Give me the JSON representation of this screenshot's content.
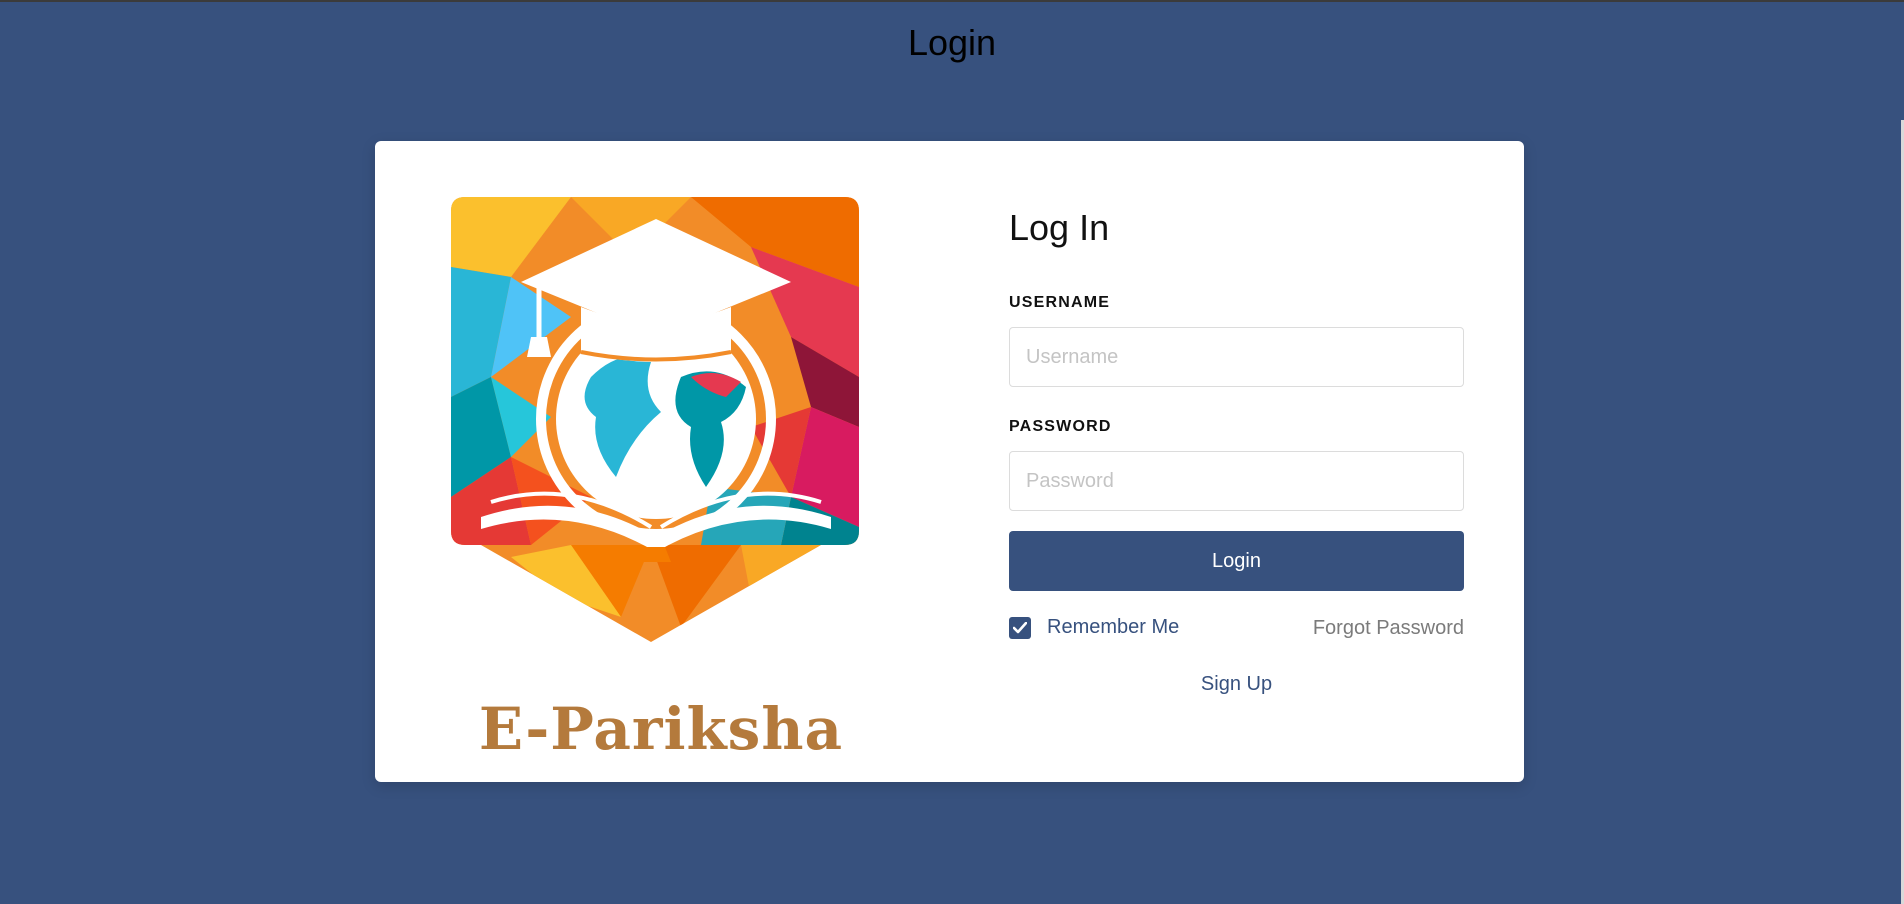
{
  "page": {
    "title": "Login"
  },
  "brand": {
    "name": "E-Pariksha"
  },
  "form": {
    "heading": "Log In",
    "username": {
      "label": "USERNAME",
      "placeholder": "Username",
      "value": ""
    },
    "password": {
      "label": "PASSWORD",
      "placeholder": "Password",
      "value": ""
    },
    "submit_label": "Login",
    "remember_label": "Remember Me",
    "remember_checked": true,
    "forgot_label": "Forgot Password",
    "signup_label": "Sign Up"
  },
  "colors": {
    "background": "#37517e",
    "primary": "#37517e",
    "card": "#ffffff",
    "muted_link": "#7b7b7b"
  },
  "icons": {
    "logo": "graduation-globe-book-logo",
    "checkbox": "check-icon"
  }
}
